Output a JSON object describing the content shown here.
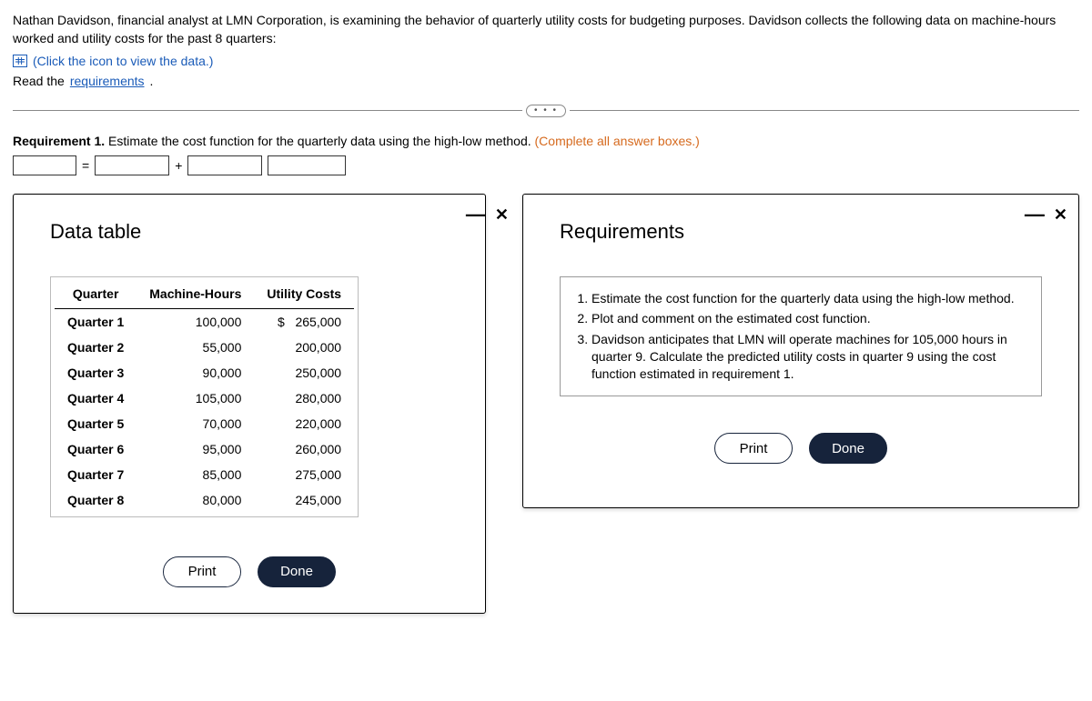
{
  "intro": "Nathan Davidson, financial analyst at LMN Corporation, is examining the behavior of quarterly utility costs for budgeting purposes. Davidson collects the following data on machine-hours worked and utility costs for the past 8 quarters:",
  "click_data": "(Click the icon to view the data.)",
  "read_prefix": "Read the ",
  "requirements_link": "requirements",
  "requirement1_label": "Requirement 1.",
  "requirement1_text": " Estimate the cost function for the quarterly data using the high-low method. ",
  "complete_hint": "(Complete all answer boxes.)",
  "eq_equals": "=",
  "eq_plus": "+",
  "data_panel_title": "Data table",
  "req_panel_title": "Requirements",
  "table": {
    "headers": {
      "quarter": "Quarter",
      "mh": "Machine-Hours",
      "cost": "Utility Costs"
    },
    "rows": [
      {
        "quarter": "Quarter 1",
        "mh": "100,000",
        "cost": "265,000"
      },
      {
        "quarter": "Quarter 2",
        "mh": "55,000",
        "cost": "200,000"
      },
      {
        "quarter": "Quarter 3",
        "mh": "90,000",
        "cost": "250,000"
      },
      {
        "quarter": "Quarter 4",
        "mh": "105,000",
        "cost": "280,000"
      },
      {
        "quarter": "Quarter 5",
        "mh": "70,000",
        "cost": "220,000"
      },
      {
        "quarter": "Quarter 6",
        "mh": "95,000",
        "cost": "260,000"
      },
      {
        "quarter": "Quarter 7",
        "mh": "85,000",
        "cost": "275,000"
      },
      {
        "quarter": "Quarter 8",
        "mh": "80,000",
        "cost": "245,000"
      }
    ]
  },
  "requirements_list": [
    "Estimate the cost function for the quarterly data using the high-low method.",
    "Plot and comment on the estimated cost function.",
    "Davidson anticipates that LMN will operate machines for 105,000 hours in quarter 9. Calculate the predicted utility costs in quarter 9 using the cost function estimated in requirement 1."
  ],
  "buttons": {
    "print": "Print",
    "done": "Done"
  },
  "ellipsis": "• • •"
}
